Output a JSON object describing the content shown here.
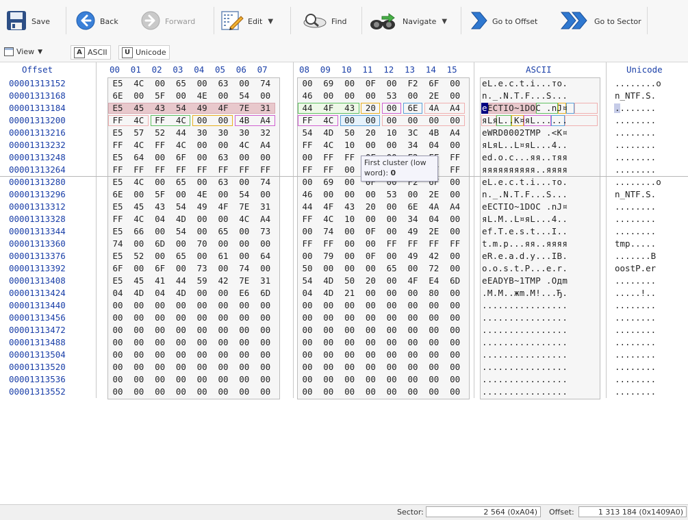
{
  "toolbar": {
    "save": "Save",
    "back": "Back",
    "forward": "Forward",
    "edit": "Edit",
    "find": "Find",
    "navigate": "Navigate",
    "go_to_offset": "Go to Offset",
    "go_to_sector": "Go to Sector",
    "dropdown_glyph": "▼"
  },
  "viewbar": {
    "view": "View",
    "ascii_letter": "A",
    "ascii": "ASCII",
    "unicode_letter": "U",
    "unicode": "Unicode"
  },
  "headers": {
    "offset": "Offset",
    "ascii": "ASCII",
    "unicode": "Unicode",
    "cols": [
      "00",
      "01",
      "02",
      "03",
      "04",
      "05",
      "06",
      "07",
      "08",
      "09",
      "10",
      "11",
      "12",
      "13",
      "14",
      "15"
    ]
  },
  "rows": [
    {
      "offset": "00001313152",
      "bytes": [
        "E5",
        "4C",
        "00",
        "65",
        "00",
        "63",
        "00",
        "74",
        "00",
        "69",
        "00",
        "0F",
        "00",
        "F2",
        "6F",
        "00"
      ],
      "ascii": "eL.e.c.t.i...то.",
      "unicode": "........o"
    },
    {
      "offset": "00001313168",
      "bytes": [
        "6E",
        "00",
        "5F",
        "00",
        "4E",
        "00",
        "54",
        "00",
        "46",
        "00",
        "00",
        "00",
        "53",
        "00",
        "2E",
        "00"
      ],
      "ascii": "n._.N.T.F...S...",
      "unicode": "n_NTF.S."
    },
    {
      "offset": "00001313184",
      "bytes": [
        "E5",
        "45",
        "43",
        "54",
        "49",
        "4F",
        "7E",
        "31",
        "44",
        "4F",
        "43",
        "20",
        "00",
        "6E",
        "4A",
        "A4"
      ],
      "ascii": "eECTIO~1DOC .nJ¤",
      "unicode": "........"
    },
    {
      "offset": "00001313200",
      "bytes": [
        "FF",
        "4C",
        "FF",
        "4C",
        "00",
        "00",
        "4B",
        "A4",
        "FF",
        "4C",
        "00",
        "00",
        "00",
        "00",
        "00",
        "00"
      ],
      "ascii": "яLяL..K¤яL......",
      "unicode": "........"
    },
    {
      "offset": "00001313216",
      "bytes": [
        "E5",
        "57",
        "52",
        "44",
        "30",
        "30",
        "30",
        "32",
        "54",
        "4D",
        "50",
        "20",
        "10",
        "3C",
        "4B",
        "A4"
      ],
      "ascii": "eWRD0002TMP .<K¤",
      "unicode": "........"
    },
    {
      "offset": "00001313232",
      "bytes": [
        "FF",
        "4C",
        "FF",
        "4C",
        "00",
        "00",
        "4C",
        "A4",
        "FF",
        "4C",
        "10",
        "00",
        "00",
        "34",
        "04",
        "00"
      ],
      "ascii": "яLяL..L¤яL...4..",
      "unicode": "........"
    },
    {
      "offset": "00001313248",
      "bytes": [
        "E5",
        "64",
        "00",
        "6F",
        "00",
        "63",
        "00",
        "00",
        "00",
        "FF",
        "FF",
        "0F",
        "00",
        "F2",
        "FF",
        "FF"
      ],
      "ascii": "ed.o.c...яя..тяя",
      "unicode": "........"
    },
    {
      "offset": "00001313264",
      "bytes": [
        "FF",
        "FF",
        "FF",
        "FF",
        "FF",
        "FF",
        "FF",
        "FF",
        "FF",
        "FF",
        "00",
        "00",
        "FF",
        "FF",
        "FF",
        "FF"
      ],
      "ascii": "яяяяяяяяяя..яяяя",
      "unicode": "........"
    },
    {
      "offset": "00001313280",
      "bytes": [
        "E5",
        "4C",
        "00",
        "65",
        "00",
        "63",
        "00",
        "74",
        "00",
        "69",
        "00",
        "0F",
        "00",
        "F2",
        "6F",
        "00"
      ],
      "ascii": "eL.e.c.t.i...то.",
      "unicode": "........o"
    },
    {
      "offset": "00001313296",
      "bytes": [
        "6E",
        "00",
        "5F",
        "00",
        "4E",
        "00",
        "54",
        "00",
        "46",
        "00",
        "00",
        "00",
        "53",
        "00",
        "2E",
        "00"
      ],
      "ascii": "n._.N.T.F...S...",
      "unicode": "n_NTF.S."
    },
    {
      "offset": "00001313312",
      "bytes": [
        "E5",
        "45",
        "43",
        "54",
        "49",
        "4F",
        "7E",
        "31",
        "44",
        "4F",
        "43",
        "20",
        "00",
        "6E",
        "4A",
        "A4"
      ],
      "ascii": "eECTIO~1DOC .nJ¤",
      "unicode": "........"
    },
    {
      "offset": "00001313328",
      "bytes": [
        "FF",
        "4C",
        "04",
        "4D",
        "00",
        "00",
        "4C",
        "A4",
        "FF",
        "4C",
        "10",
        "00",
        "00",
        "34",
        "04",
        "00"
      ],
      "ascii": "яL.M..L¤яL...4..",
      "unicode": "........"
    },
    {
      "offset": "00001313344",
      "bytes": [
        "E5",
        "66",
        "00",
        "54",
        "00",
        "65",
        "00",
        "73",
        "00",
        "74",
        "00",
        "0F",
        "00",
        "49",
        "2E",
        "00"
      ],
      "ascii": "ef.T.e.s.t...I..",
      "unicode": "........"
    },
    {
      "offset": "00001313360",
      "bytes": [
        "74",
        "00",
        "6D",
        "00",
        "70",
        "00",
        "00",
        "00",
        "FF",
        "FF",
        "00",
        "00",
        "FF",
        "FF",
        "FF",
        "FF"
      ],
      "ascii": "t.m.p...яя..яяяя",
      "unicode": "tmp....."
    },
    {
      "offset": "00001313376",
      "bytes": [
        "E5",
        "52",
        "00",
        "65",
        "00",
        "61",
        "00",
        "64",
        "00",
        "79",
        "00",
        "0F",
        "00",
        "49",
        "42",
        "00"
      ],
      "ascii": "eR.e.a.d.y...IB.",
      "unicode": ".......B"
    },
    {
      "offset": "00001313392",
      "bytes": [
        "6F",
        "00",
        "6F",
        "00",
        "73",
        "00",
        "74",
        "00",
        "50",
        "00",
        "00",
        "00",
        "65",
        "00",
        "72",
        "00"
      ],
      "ascii": "o.o.s.t.P...e.r.",
      "unicode": "oostP.er"
    },
    {
      "offset": "00001313408",
      "bytes": [
        "E5",
        "45",
        "41",
        "44",
        "59",
        "42",
        "7E",
        "31",
        "54",
        "4D",
        "50",
        "20",
        "00",
        "4F",
        "E4",
        "6D"
      ],
      "ascii": "eEADYB~1TMP .Oдm",
      "unicode": "........"
    },
    {
      "offset": "00001313424",
      "bytes": [
        "04",
        "4D",
        "04",
        "4D",
        "00",
        "00",
        "E6",
        "6D",
        "04",
        "4D",
        "21",
        "00",
        "00",
        "00",
        "80",
        "00"
      ],
      "ascii": ".M.M..жm.M!...Ђ.",
      "unicode": ".....!.."
    },
    {
      "offset": "00001313440",
      "bytes": [
        "00",
        "00",
        "00",
        "00",
        "00",
        "00",
        "00",
        "00",
        "00",
        "00",
        "00",
        "00",
        "00",
        "00",
        "00",
        "00"
      ],
      "ascii": "................",
      "unicode": "........"
    },
    {
      "offset": "00001313456",
      "bytes": [
        "00",
        "00",
        "00",
        "00",
        "00",
        "00",
        "00",
        "00",
        "00",
        "00",
        "00",
        "00",
        "00",
        "00",
        "00",
        "00"
      ],
      "ascii": "................",
      "unicode": "........"
    },
    {
      "offset": "00001313472",
      "bytes": [
        "00",
        "00",
        "00",
        "00",
        "00",
        "00",
        "00",
        "00",
        "00",
        "00",
        "00",
        "00",
        "00",
        "00",
        "00",
        "00"
      ],
      "ascii": "................",
      "unicode": "........"
    },
    {
      "offset": "00001313488",
      "bytes": [
        "00",
        "00",
        "00",
        "00",
        "00",
        "00",
        "00",
        "00",
        "00",
        "00",
        "00",
        "00",
        "00",
        "00",
        "00",
        "00"
      ],
      "ascii": "................",
      "unicode": "........"
    },
    {
      "offset": "00001313504",
      "bytes": [
        "00",
        "00",
        "00",
        "00",
        "00",
        "00",
        "00",
        "00",
        "00",
        "00",
        "00",
        "00",
        "00",
        "00",
        "00",
        "00"
      ],
      "ascii": "................",
      "unicode": "........"
    },
    {
      "offset": "00001313520",
      "bytes": [
        "00",
        "00",
        "00",
        "00",
        "00",
        "00",
        "00",
        "00",
        "00",
        "00",
        "00",
        "00",
        "00",
        "00",
        "00",
        "00"
      ],
      "ascii": "................",
      "unicode": "........"
    },
    {
      "offset": "00001313536",
      "bytes": [
        "00",
        "00",
        "00",
        "00",
        "00",
        "00",
        "00",
        "00",
        "00",
        "00",
        "00",
        "00",
        "00",
        "00",
        "00",
        "00"
      ],
      "ascii": "................",
      "unicode": "........"
    },
    {
      "offset": "00001313552",
      "bytes": [
        "00",
        "00",
        "00",
        "00",
        "00",
        "00",
        "00",
        "00",
        "00",
        "00",
        "00",
        "00",
        "00",
        "00",
        "00",
        "00"
      ],
      "ascii": "................",
      "unicode": "........"
    }
  ],
  "tooltip": {
    "line1": "First cluster (low",
    "line2": "word): ",
    "value": "0"
  },
  "status": {
    "sector_label": "Sector:",
    "sector_value": "2 564 (0xA04)",
    "offset_label": "Offset:",
    "offset_value": "1 313 184 (0x1409A0)"
  },
  "colors": {
    "offset_blue": "#1a3fa8",
    "selection_navy": "#000080",
    "name_field": "#d8a8b0",
    "ext_field": "#f0b0b0",
    "attr_field": "#e8b020",
    "green_field": "#60c060",
    "blue_field": "#5aa0d8",
    "magenta_field": "#d060d0"
  },
  "icons": [
    "save-icon",
    "back-icon",
    "forward-icon",
    "edit-icon",
    "find-icon",
    "navigate-icon",
    "go-to-offset-icon",
    "go-to-sector-icon",
    "view-icon"
  ]
}
